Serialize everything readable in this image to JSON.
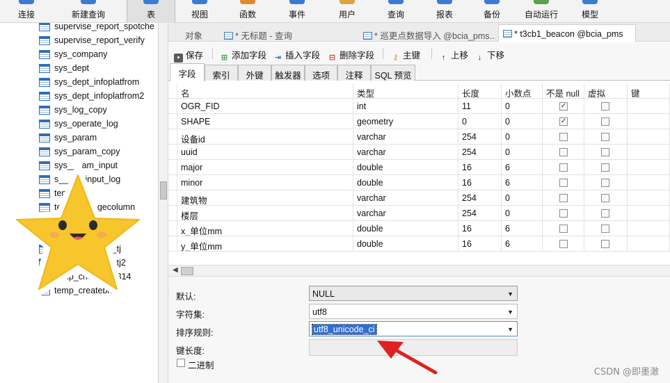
{
  "toolbar": {
    "buttons": [
      {
        "label": "连接",
        "color": "#3b7bd4"
      },
      {
        "label": "新建查询",
        "color": "#3b7bd4"
      },
      {
        "label": "表",
        "color": "#3b7bd4"
      },
      {
        "label": "视图",
        "color": "#3b7bd4"
      },
      {
        "label": "函数",
        "color": "#e08a2c"
      },
      {
        "label": "事件",
        "color": "#3b7bd4"
      },
      {
        "label": "用户",
        "color": "#d9a441"
      },
      {
        "label": "查询",
        "color": "#3b7bd4"
      },
      {
        "label": "报表",
        "color": "#3b7bd4"
      },
      {
        "label": "备份",
        "color": "#3b7bd4"
      },
      {
        "label": "自动运行",
        "color": "#5ba14a"
      },
      {
        "label": "模型",
        "color": "#3b7bd4"
      }
    ]
  },
  "sidebar": {
    "tables": [
      "supervise_report_spotche",
      "supervise_report_verify",
      "sys_company",
      "sys_dept",
      "sys_dept_infoplatfrom",
      "sys_dept_infoplatfrom2",
      "sys_log_copy",
      "sys_operate_log",
      "sys_param",
      "sys_param_copy",
      "sys___am_input",
      "s___ __input_log",
      "temp_bn",
      "temp_changecolumn",
      "temp_changefield",
      "temp_check_num",
      "temp_checklist_tj",
      "temp_checklist_tj2",
      "temp_checklist0314",
      "temp_createbm"
    ]
  },
  "editor_tabs": [
    {
      "label": "对象"
    },
    {
      "label": "* 无标题 - 查询"
    },
    {
      "label": "* 巡更点数据导入 @bcia_pms..."
    },
    {
      "label": "* t3cb1_beacon @bcia_pms"
    }
  ],
  "design_toolbar": {
    "save": "保存",
    "add_field": "添加字段",
    "insert_field": "插入字段",
    "delete_field": "删除字段",
    "primary_key": "主键",
    "move_up": "上移",
    "move_down": "下移"
  },
  "sub_tabs": [
    "字段",
    "索引",
    "外键",
    "触发器",
    "选项",
    "注释",
    "SQL 预览"
  ],
  "grid": {
    "headers": {
      "name": "名",
      "type": "类型",
      "length": "长度",
      "decimals": "小数点",
      "not_null": "不是 null",
      "virtual": "虚拟",
      "key": "键"
    },
    "rows": [
      {
        "name": "OGR_FID",
        "type": "int",
        "length": "11",
        "decimals": "0",
        "not_null": true,
        "virtual": false
      },
      {
        "name": "SHAPE",
        "type": "geometry",
        "length": "0",
        "decimals": "0",
        "not_null": true,
        "virtual": false
      },
      {
        "name": "设备id",
        "type": "varchar",
        "length": "254",
        "decimals": "0",
        "not_null": false,
        "virtual": false
      },
      {
        "name": "uuid",
        "type": "varchar",
        "length": "254",
        "decimals": "0",
        "not_null": false,
        "virtual": false
      },
      {
        "name": "major",
        "type": "double",
        "length": "16",
        "decimals": "6",
        "not_null": false,
        "virtual": false
      },
      {
        "name": "minor",
        "type": "double",
        "length": "16",
        "decimals": "6",
        "not_null": false,
        "virtual": false
      },
      {
        "name": "建筑物",
        "type": "varchar",
        "length": "254",
        "decimals": "0",
        "not_null": false,
        "virtual": false
      },
      {
        "name": "楼层",
        "type": "varchar",
        "length": "254",
        "decimals": "0",
        "not_null": false,
        "virtual": false
      },
      {
        "name": "x_单位mm",
        "type": "double",
        "length": "16",
        "decimals": "6",
        "not_null": false,
        "virtual": false
      },
      {
        "name": "y_单位mm",
        "type": "double",
        "length": "16",
        "decimals": "6",
        "not_null": false,
        "virtual": false
      }
    ]
  },
  "properties": {
    "default_label": "默认:",
    "default_value": "NULL",
    "charset_label": "字符集:",
    "charset_value": "utf8",
    "collation_label": "排序规则:",
    "collation_value": "utf8_unicode_ci",
    "keylen_label": "键长度:",
    "binary_label": "二进制"
  },
  "watermark": "CSDN @即墨澈"
}
